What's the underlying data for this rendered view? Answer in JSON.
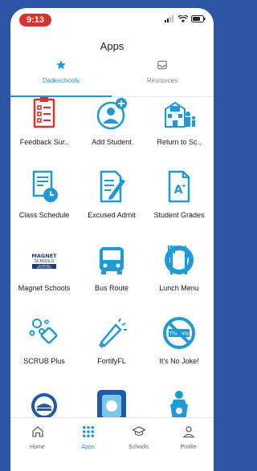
{
  "status": {
    "time": "9:13"
  },
  "header": {
    "title": "Apps"
  },
  "tabs": [
    {
      "label": "Dadeschools",
      "icon": "star-icon",
      "active": true
    },
    {
      "label": "Resources",
      "icon": "inbox-icon",
      "active": false
    }
  ],
  "apps": [
    {
      "label": "Feedback Sur..",
      "icon": "clipboard-icon"
    },
    {
      "label": "Add Student",
      "icon": "add-user-icon"
    },
    {
      "label": "Return to Sc..",
      "icon": "school-family-icon"
    },
    {
      "label": "Class Schedule",
      "icon": "schedule-icon"
    },
    {
      "label": "Excused Admit",
      "icon": "document-pen-icon"
    },
    {
      "label": "Student Grades",
      "icon": "grade-document-icon"
    },
    {
      "label": "Magnet Schools",
      "icon": "magnet-schools-logo",
      "logo_text": [
        "MAGNET",
        "SCHOOLS",
        "ACCEPTING",
        "APPLICATIONS"
      ]
    },
    {
      "label": "Bus Route",
      "icon": "bus-icon"
    },
    {
      "label": "Lunch Menu",
      "icon": "utensils-icon"
    },
    {
      "label": "SCRUB Plus",
      "icon": "bubbles-icon"
    },
    {
      "label": "FortifyFL",
      "icon": "megaphone-icon"
    },
    {
      "label": "It's No Joke!",
      "icon": "no-threats-icon",
      "logo_text": [
        "Threats"
      ]
    },
    {
      "label": "",
      "icon": "district-seal-icon"
    },
    {
      "label": "",
      "icon": "tablet-app-icon"
    },
    {
      "label": "",
      "icon": "podium-icon"
    }
  ],
  "bottom_nav": [
    {
      "label": "Home",
      "icon": "home-icon",
      "active": false
    },
    {
      "label": "Apps",
      "icon": "grid-icon",
      "active": true
    },
    {
      "label": "Schools",
      "icon": "graduation-cap-icon",
      "active": false
    },
    {
      "label": "Profile",
      "icon": "profile-icon",
      "active": false
    }
  ],
  "colors": {
    "accent": "#1f9ad6",
    "red": "#d9342b",
    "background": "#2c56a3"
  }
}
